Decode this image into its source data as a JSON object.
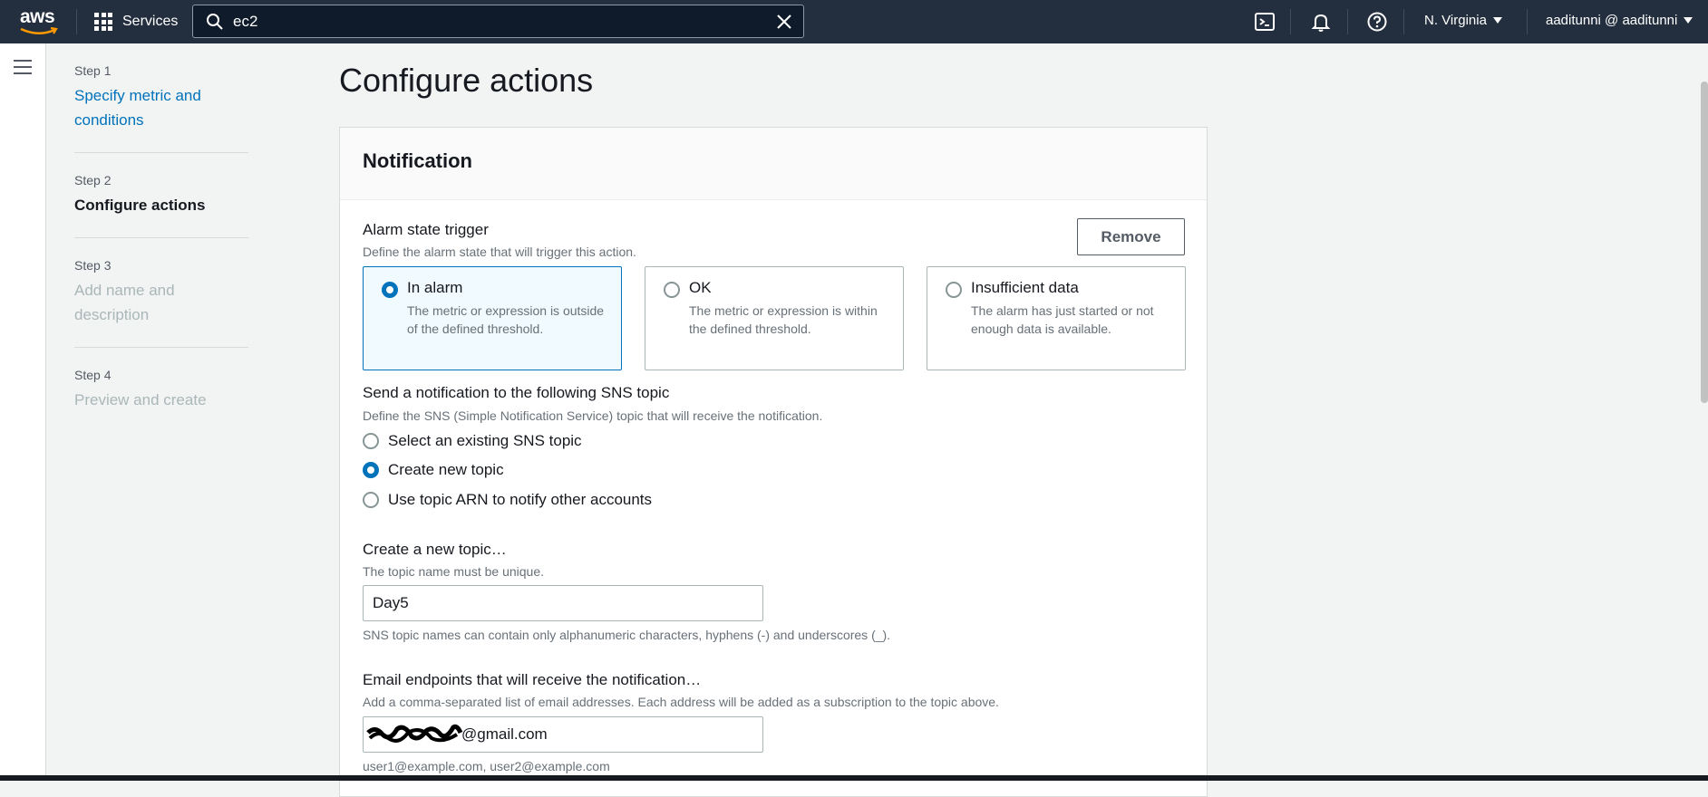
{
  "topnav": {
    "logo_text": "aws",
    "services_label": "Services",
    "search_value": "ec2",
    "region_label": "N. Virginia",
    "user_label": "aaditunni @ aaditunni"
  },
  "steps": [
    {
      "num": "Step 1",
      "title": "Specify metric and conditions"
    },
    {
      "num": "Step 2",
      "title": "Configure actions"
    },
    {
      "num": "Step 3",
      "title": "Add name and description"
    },
    {
      "num": "Step 4",
      "title": "Preview and create"
    }
  ],
  "page": {
    "title": "Configure actions"
  },
  "notification": {
    "title": "Notification",
    "remove_label": "Remove",
    "trigger_label": "Alarm state trigger",
    "trigger_desc": "Define the alarm state that will trigger this action.",
    "tiles": [
      {
        "label": "In alarm",
        "desc": "The metric or expression is outside of the defined threshold.",
        "selected": true
      },
      {
        "label": "OK",
        "desc": "The metric or expression is within the defined threshold.",
        "selected": false
      },
      {
        "label": "Insufficient data",
        "desc": "The alarm has just started or not enough data is available.",
        "selected": false
      }
    ],
    "sns_label": "Send a notification to the following SNS topic",
    "sns_desc": "Define the SNS (Simple Notification Service) topic that will receive the notification.",
    "sns_options": [
      {
        "label": "Select an existing SNS topic",
        "selected": false
      },
      {
        "label": "Create new topic",
        "selected": true
      },
      {
        "label": "Use topic ARN to notify other accounts",
        "selected": false
      }
    ],
    "new_topic_label": "Create a new topic…",
    "new_topic_desc": "The topic name must be unique.",
    "new_topic_value": "Day5",
    "new_topic_hint": "SNS topic names can contain only alphanumeric characters, hyphens (-) and underscores (_).",
    "email_label": "Email endpoints that will receive the notification…",
    "email_desc": "Add a comma-separated list of email addresses. Each address will be added as a subscription to the topic above.",
    "email_value": "@gmail.com",
    "email_hint": "user1@example.com, user2@example.com"
  },
  "colors": {
    "nav_bg": "#232f3e",
    "accent": "#0073bb",
    "aws_orange": "#ff9900"
  }
}
